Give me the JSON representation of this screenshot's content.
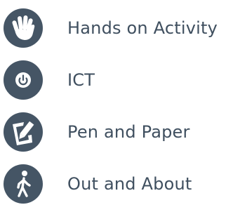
{
  "legend": {
    "items": [
      {
        "icon": "hand-icon",
        "label": "Hands on Activity"
      },
      {
        "icon": "power-icon",
        "label": "ICT"
      },
      {
        "icon": "pencil-paper-icon",
        "label": "Pen and Paper"
      },
      {
        "icon": "walking-person-icon",
        "label": "Out and About"
      }
    ]
  },
  "colors": {
    "icon_bg": "#455565",
    "icon_fg": "#ffffff",
    "text": "#3f4f5f"
  }
}
